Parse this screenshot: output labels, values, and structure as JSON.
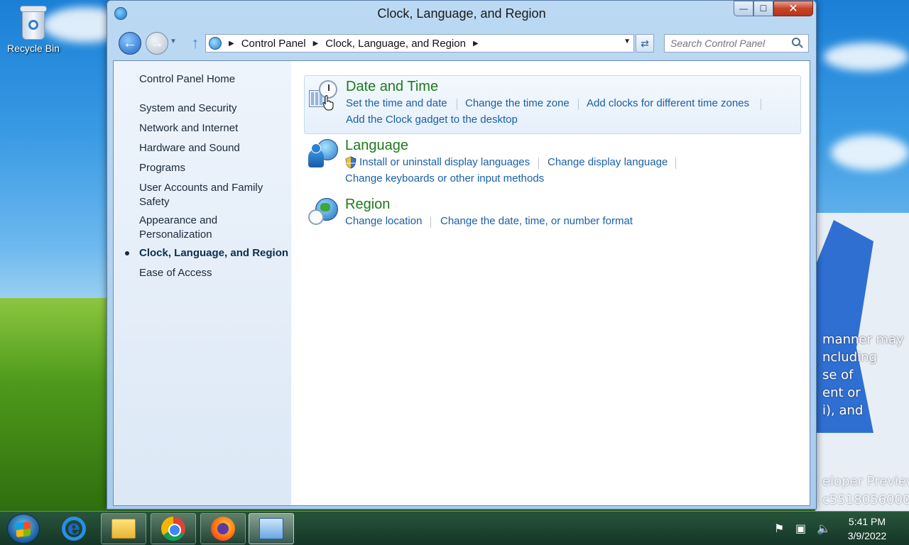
{
  "desktop": {
    "recycle_bin_label": "Recycle Bin",
    "overlay_text": [
      "manner may",
      "ncluding",
      "se of",
      "ent or",
      "i), and"
    ],
    "overlay_text_2": [
      "eloper Preview",
      "c5518056000"
    ]
  },
  "window": {
    "title": "Clock, Language, and Region",
    "caption": {
      "minimize": "—",
      "maximize": "☐",
      "close": "✕"
    }
  },
  "navbar": {
    "back": "←",
    "forward": "→",
    "breadcrumb": [
      "Control Panel",
      "Clock, Language, and Region"
    ],
    "search_placeholder": "Search Control Panel"
  },
  "sidebar": {
    "home": "Control Panel Home",
    "items": [
      {
        "label": "System and Security"
      },
      {
        "label": "Network and Internet"
      },
      {
        "label": "Hardware and Sound"
      },
      {
        "label": "Programs"
      },
      {
        "label": "User Accounts and Family Safety"
      },
      {
        "label": "Appearance and Personalization"
      },
      {
        "label": "Clock, Language, and Region",
        "current": true
      },
      {
        "label": "Ease of Access"
      }
    ]
  },
  "groups": {
    "date_time": {
      "title": "Date and Time",
      "links": [
        "Set the time and date",
        "Change the time zone",
        "Add clocks for different time zones",
        "Add the Clock gadget to the desktop"
      ]
    },
    "language": {
      "title": "Language",
      "links": [
        "Install or uninstall display languages",
        "Change display language",
        "Change keyboards or other input methods"
      ]
    },
    "region": {
      "title": "Region",
      "links": [
        "Change location",
        "Change the date, time, or number format"
      ]
    }
  },
  "taskbar": {
    "time": "5:41 PM",
    "date": "3/9/2022"
  },
  "colors": {
    "link": "#1a5fa8",
    "group_title": "#1e7a1e"
  }
}
